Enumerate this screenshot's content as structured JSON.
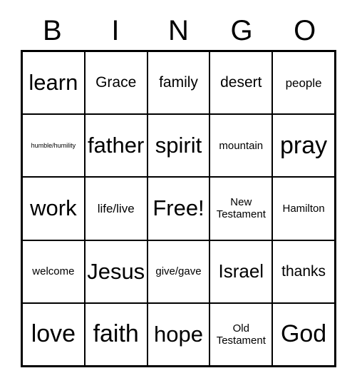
{
  "card": {
    "title": "Bingo Card",
    "header_letters": [
      "B",
      "I",
      "N",
      "G",
      "O"
    ],
    "columns": 5,
    "rows": 5,
    "colors": {
      "background": "#ffffff",
      "grid_line": "#000000",
      "text": "#000000"
    },
    "free_space": "Free!",
    "cells": [
      [
        {
          "text": "learn",
          "size": "fs-xxl"
        },
        {
          "text": "Grace",
          "size": "fs-l"
        },
        {
          "text": "family",
          "size": "fs-l"
        },
        {
          "text": "desert",
          "size": "fs-l"
        },
        {
          "text": "people",
          "size": "fs-m"
        }
      ],
      [
        {
          "text": "humble/humility",
          "size": "fs-xxs"
        },
        {
          "text": "father",
          "size": "fs-xxl"
        },
        {
          "text": "spirit",
          "size": "fs-xxl"
        },
        {
          "text": "mountain",
          "size": "fs-s"
        },
        {
          "text": "pray",
          "size": "fs-huge"
        }
      ],
      [
        {
          "text": "work",
          "size": "fs-xxl"
        },
        {
          "text": "life/live",
          "size": "fs-m"
        },
        {
          "text": "Free!",
          "size": "fs-xxl"
        },
        {
          "text": "New\nTestament",
          "size": "fs-s"
        },
        {
          "text": "Hamilton",
          "size": "fs-s"
        }
      ],
      [
        {
          "text": "welcome",
          "size": "fs-s"
        },
        {
          "text": "Jesus",
          "size": "fs-xxl"
        },
        {
          "text": "give/gave",
          "size": "fs-s"
        },
        {
          "text": "Israel",
          "size": "fs-xl"
        },
        {
          "text": "thanks",
          "size": "fs-l"
        }
      ],
      [
        {
          "text": "love",
          "size": "fs-huge"
        },
        {
          "text": "faith",
          "size": "fs-huge"
        },
        {
          "text": "hope",
          "size": "fs-xxl"
        },
        {
          "text": "Old\nTestament",
          "size": "fs-s"
        },
        {
          "text": "God",
          "size": "fs-huge"
        }
      ]
    ]
  }
}
